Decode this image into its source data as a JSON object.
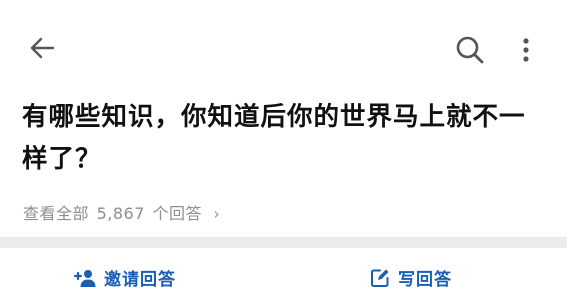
{
  "question": {
    "title": "有哪些知识，你知道后你的世界马上就不一样了？"
  },
  "answers_link": {
    "prefix": "查看全部",
    "count": "5,867",
    "suffix": "个回答",
    "chevron": "›"
  },
  "actions": {
    "invite_label": "邀请回答",
    "write_label": "写回答"
  },
  "icons": {
    "back": "arrow-left-icon",
    "search": "search-icon",
    "more": "more-vertical-icon",
    "invite": "add-person-icon",
    "write": "edit-icon"
  },
  "colors": {
    "accent": "#1a5fb4",
    "muted_text": "#8f8f8f",
    "title_text": "#111111",
    "background": "#ebebeb"
  }
}
